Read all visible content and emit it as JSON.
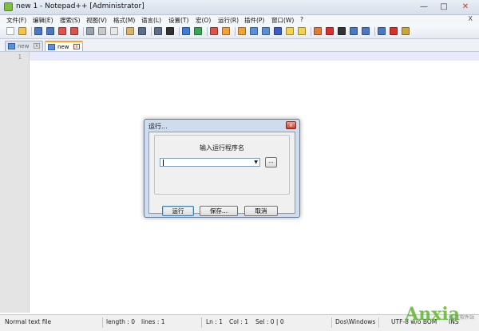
{
  "window": {
    "title": "new  1 - Notepad++ [Administrator]",
    "controls": {
      "minimize": "—",
      "maximize": "□",
      "close": "✕"
    }
  },
  "menu": {
    "items": [
      "文件(F)",
      "编辑(E)",
      "搜索(S)",
      "视图(V)",
      "格式(M)",
      "语言(L)",
      "设置(T)",
      "宏(O)",
      "运行(R)",
      "插件(P)",
      "窗口(W)",
      "?"
    ],
    "close_label": "X"
  },
  "toolbar": {
    "icons": [
      {
        "name": "new-file-icon",
        "color": "#ffffff"
      },
      {
        "name": "open-file-icon",
        "color": "#f2c14e"
      },
      {
        "name": "save-icon",
        "color": "#4a78c2"
      },
      {
        "name": "save-all-icon",
        "color": "#4a78c2"
      },
      {
        "name": "close-icon",
        "color": "#d9534f"
      },
      {
        "name": "close-all-icon",
        "color": "#d9534f"
      },
      {
        "name": "print-icon",
        "color": "#9aa3ad"
      },
      {
        "name": "cut-icon",
        "color": "#c9c9c9"
      },
      {
        "name": "copy-icon",
        "color": "#e8e8e8"
      },
      {
        "name": "paste-icon",
        "color": "#d8b36a"
      },
      {
        "name": "undo-icon",
        "color": "#5d6f86"
      },
      {
        "name": "redo-icon",
        "color": "#5d6f86"
      },
      {
        "name": "find-icon",
        "color": "#333333"
      },
      {
        "name": "replace-icon",
        "color": "#3b7dd8"
      },
      {
        "name": "zoom-in-icon",
        "color": "#3aa655"
      },
      {
        "name": "zoom-out-icon",
        "color": "#d9534f"
      },
      {
        "name": "sync-vertical-icon",
        "color": "#f0a33a"
      },
      {
        "name": "sync-horizontal-icon",
        "color": "#f0a33a"
      },
      {
        "name": "word-wrap-icon",
        "color": "#5b8fd6"
      },
      {
        "name": "show-all-chars-icon",
        "color": "#5b8fd6"
      },
      {
        "name": "indent-guide-icon",
        "color": "#3b5ec8"
      },
      {
        "name": "user-language-icon",
        "color": "#f2d24e"
      },
      {
        "name": "doc-map-icon",
        "color": "#f2d24e"
      },
      {
        "name": "function-list-icon",
        "color": "#e07b39"
      },
      {
        "name": "record-macro-icon",
        "color": "#d9302c"
      },
      {
        "name": "stop-record-icon",
        "color": "#333333"
      },
      {
        "name": "play-macro-icon",
        "color": "#4a78c2"
      },
      {
        "name": "run-macro-multiple-icon",
        "color": "#4a78c2"
      },
      {
        "name": "save-macro-icon",
        "color": "#4a78c2"
      },
      {
        "name": "spellcheck-icon",
        "color": "#d9302c"
      },
      {
        "name": "plugin-icon",
        "color": "#c9a63a"
      }
    ]
  },
  "tabs": [
    {
      "label": "new",
      "active": false
    },
    {
      "label": "new",
      "active": true
    }
  ],
  "editor": {
    "line_number": "1",
    "current_line_color": "#e8e8ff"
  },
  "statusbar": {
    "file_type": "Normal text file",
    "length": "length : 0",
    "lines": "lines : 1",
    "ln": "Ln : 1",
    "col": "Col : 1",
    "sel": "Sel : 0 | 0",
    "eol": "Dos\\Windows",
    "encoding": "UTF-8 w/o BOM",
    "mode": "INS",
    "watermark": "Anxia",
    "watermark_sub": "安下软件站"
  },
  "dialog": {
    "title": "运行...",
    "heading": "输入运行程序名",
    "input_value": "",
    "browse_label": "...",
    "buttons": {
      "run": "运行",
      "save": "保存...",
      "cancel": "取消"
    }
  }
}
